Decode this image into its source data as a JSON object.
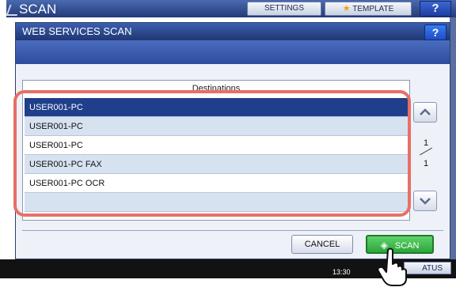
{
  "background": {
    "app_title": "SCAN",
    "settings_label": "SETTINGS",
    "template_label": "TEMPLATE",
    "help_label": "?",
    "time_text": "13:30",
    "status_label": "ATUS"
  },
  "dialog": {
    "title": "WEB SERVICES SCAN",
    "help_label": "?",
    "list_header": "Destinations",
    "rows": [
      {
        "label": "USER001-PC",
        "selected": true
      },
      {
        "label": "USER001-PC",
        "selected": false
      },
      {
        "label": "USER001-PC",
        "selected": false
      },
      {
        "label": "USER001-PC FAX",
        "selected": false
      },
      {
        "label": "USER001-PC OCR",
        "selected": false
      },
      {
        "label": "",
        "selected": false
      }
    ],
    "page_current": "1",
    "page_total": "1",
    "cancel_label": "CANCEL",
    "scan_label": "SCAN"
  },
  "colors": {
    "selected_row": "#1f3e8c",
    "highlight": "#e86f66",
    "scan_button": "#2ba63a"
  },
  "icons": [
    "arrow-up-icon",
    "arrow-down-icon",
    "scan-diamond-icon",
    "pointer-hand-icon",
    "star-icon"
  ]
}
